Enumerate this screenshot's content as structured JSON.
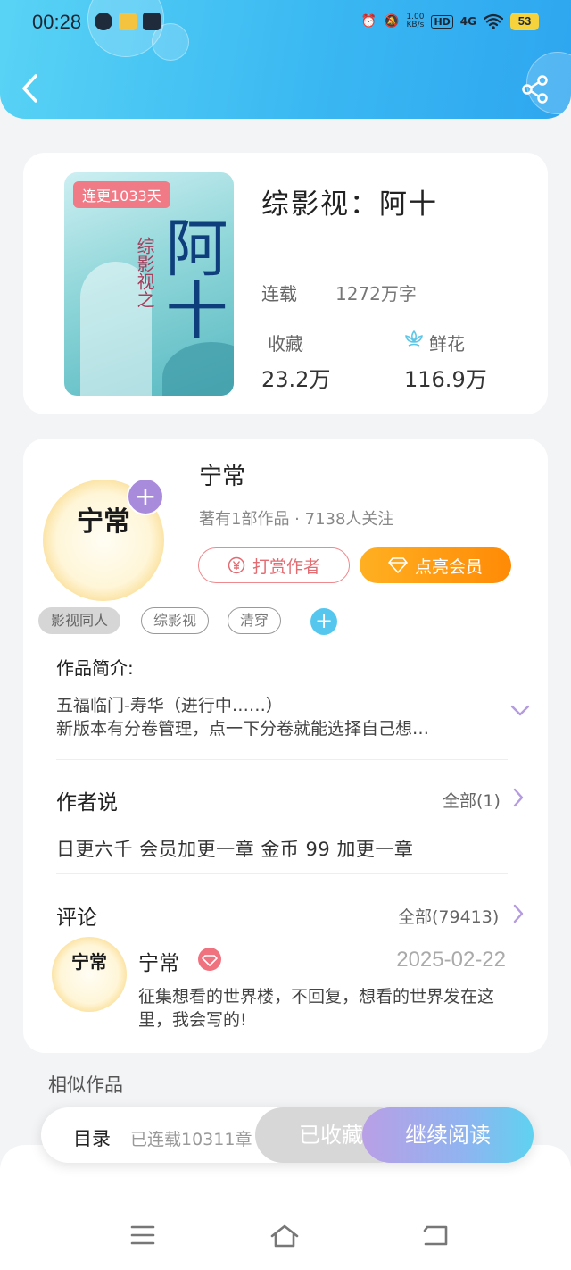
{
  "status_bar": {
    "time": "00:28",
    "net_speed": "1.00\nKB/s",
    "hd": "HD",
    "signal": "4G",
    "battery": "53"
  },
  "book": {
    "cover_badge": "连更1033天",
    "cover_title": "阿十",
    "cover_subtitle": "综影视之",
    "title": "综影视：阿十",
    "status": "连载",
    "word_count": "1272万字",
    "collect_label": "收藏",
    "collect_value": "23.2万",
    "flower_label": "鲜花",
    "flower_value": "116.9万"
  },
  "author": {
    "name": "宁常",
    "meta": "著有1部作品 · 7138人关注",
    "avatar_text": "宁常",
    "follow_symbol": "+",
    "tip_label": "打赏作者",
    "vip_label": "点亮会员"
  },
  "tags": [
    "影视同人",
    "综影视",
    "清穿"
  ],
  "intro": {
    "title": "作品简介:",
    "line1": "五福临门-寿华（进行中……）",
    "line2": "新版本有分卷管理，点一下分卷就能选择自己想…"
  },
  "author_says": {
    "title": "作者说",
    "more": "全部(1)",
    "text": "日更六千  会员加更一章  金币 99 加更一章"
  },
  "comments": {
    "title": "评论",
    "more": "全部(79413)",
    "item": {
      "name": "宁常",
      "date": "2025-02-22",
      "text": "征集想看的世界楼，不回复，想看的世界发在这里，我会写的!"
    }
  },
  "similar_title": "相似作品",
  "action_bar": {
    "toc_label": "目录",
    "toc_info": "已连载10311章",
    "collected_label": "已收藏",
    "read_label": "继续阅读"
  },
  "colors": {
    "header_gradient": [
      "#59d3f5",
      "#2ea6f0"
    ],
    "vip_orange": "#ff8a06",
    "tip_red": "#e26c72",
    "accent_purple": "#a98bdc"
  },
  "icons": [
    "back-icon",
    "share-icon",
    "flower-icon",
    "coin-icon",
    "diamond-icon",
    "plus-icon",
    "chevron-down-icon",
    "chevron-right-icon",
    "menu-icon",
    "home-icon",
    "return-icon"
  ]
}
